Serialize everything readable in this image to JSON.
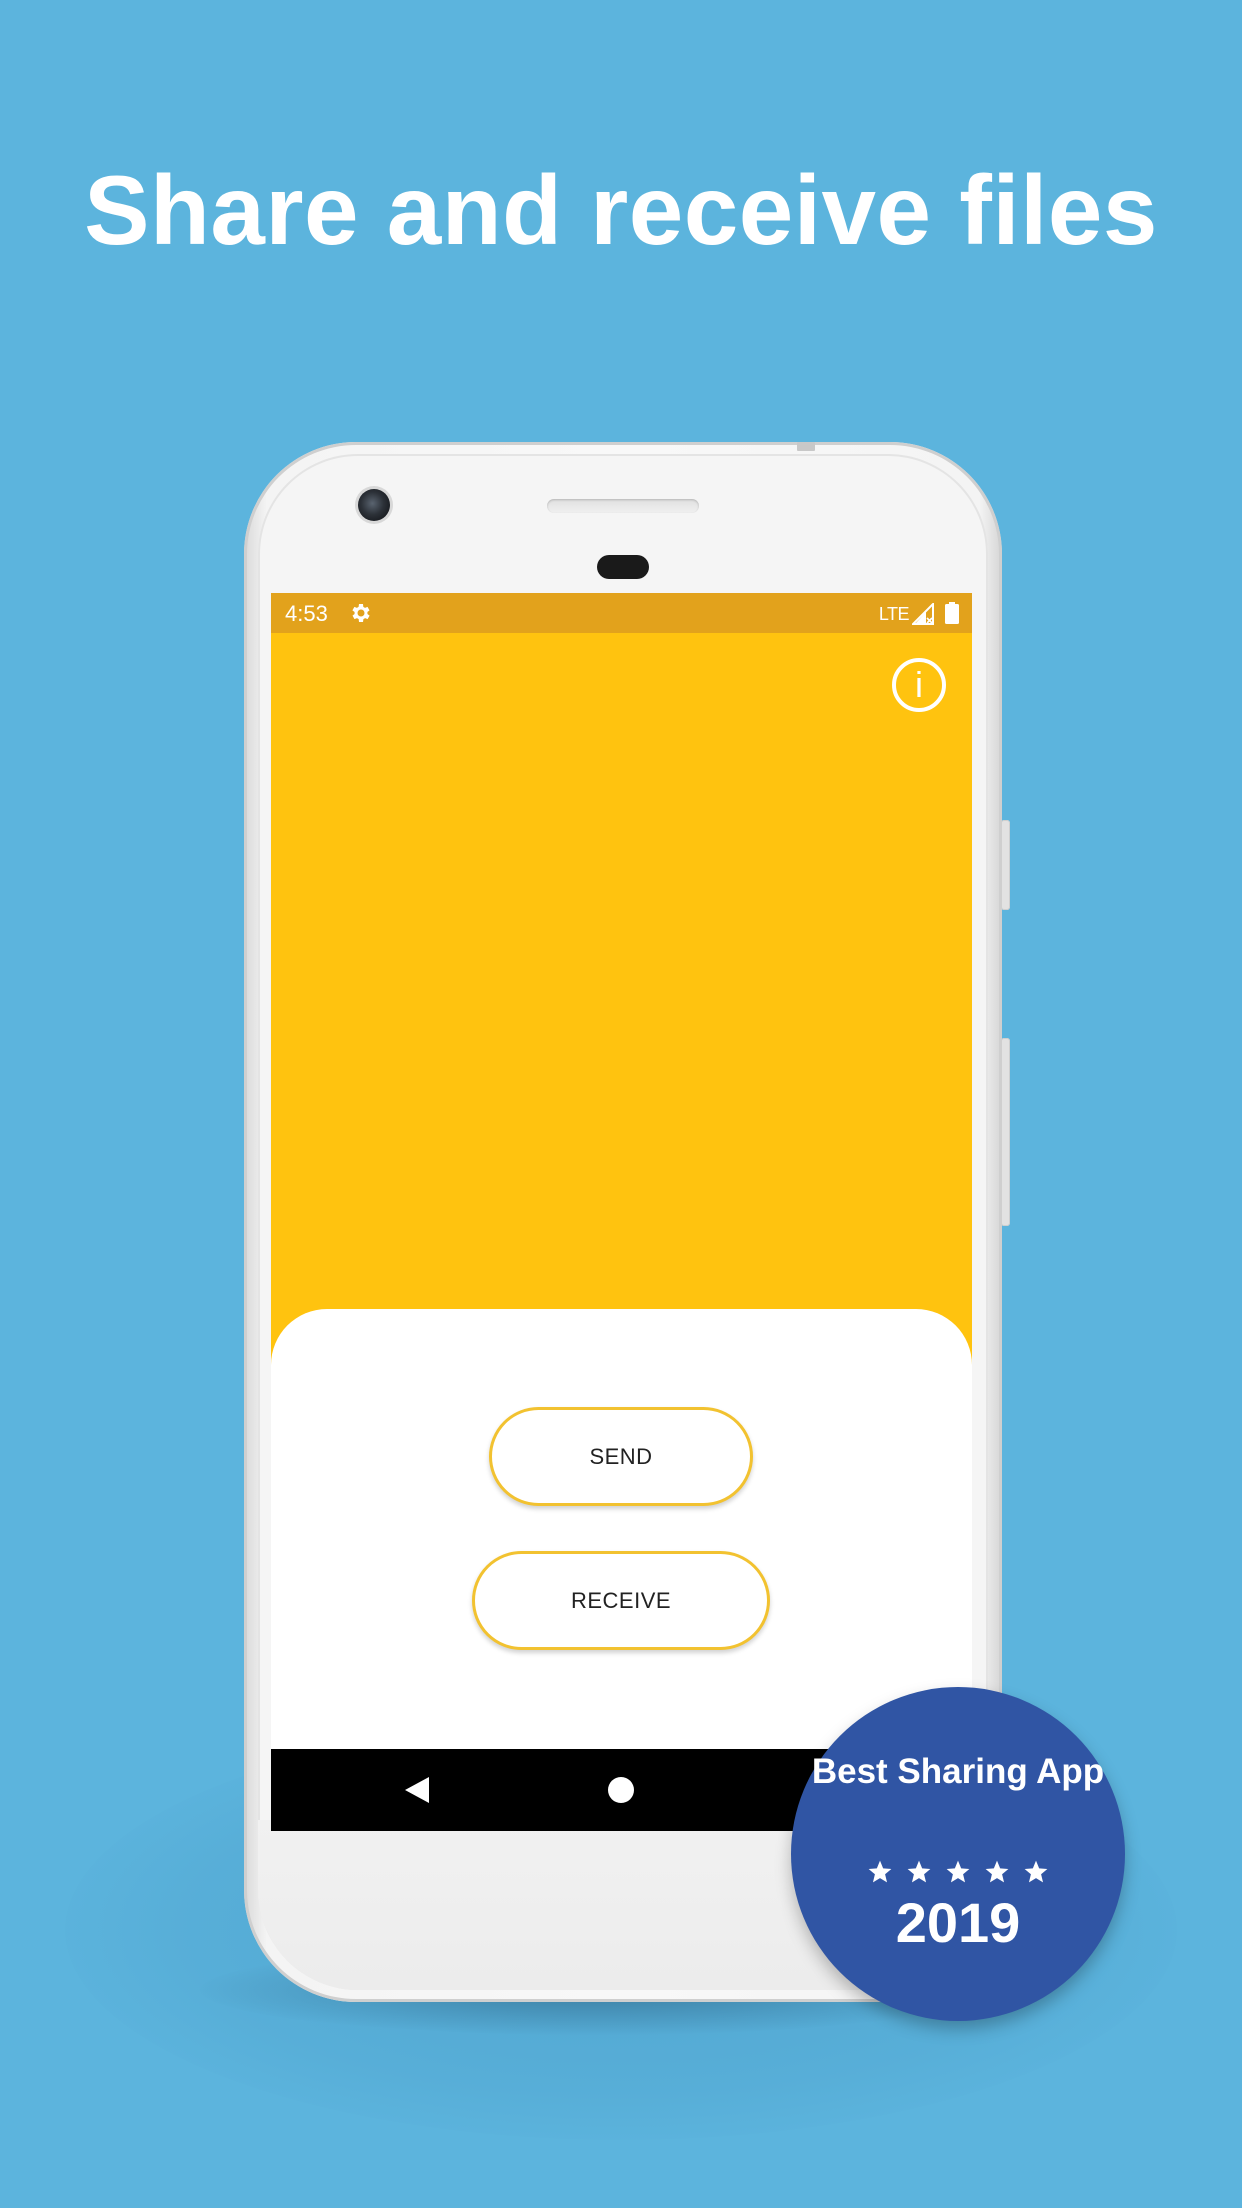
{
  "headline": "Share and receive files",
  "colors": {
    "background": "#5cb4dd",
    "app_primary": "#ffc30f",
    "status_bar": "#e2a21c",
    "button_border": "#f2c230",
    "badge": "#3055a4"
  },
  "status_bar": {
    "time": "4:53",
    "network": "LTE",
    "icons": [
      "gear-icon",
      "signal-icon",
      "battery-icon"
    ]
  },
  "app": {
    "info_icon_label": "i",
    "send_label": "SEND",
    "receive_label": "RECEIVE"
  },
  "nav_bar": {
    "icons": [
      "back-icon",
      "home-icon"
    ]
  },
  "badge": {
    "title": "Best Sharing App",
    "stars": 5,
    "year": "2019"
  }
}
